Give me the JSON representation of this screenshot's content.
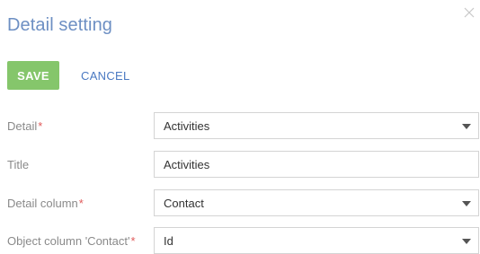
{
  "dialog": {
    "title": "Detail setting"
  },
  "toolbar": {
    "save_label": "SAVE",
    "cancel_label": "CANCEL"
  },
  "icons": {
    "close": "close-icon",
    "dropdown": "chevron-down-icon"
  },
  "colors": {
    "title": "#6d8fc3",
    "save_bg": "#85c66b",
    "cancel": "#4a79c2",
    "required": "#e05a5a"
  },
  "fields": {
    "detail": {
      "label": "Detail",
      "required_mark": "*",
      "value": "Activities"
    },
    "title": {
      "label": "Title",
      "value": "Activities"
    },
    "detail_column": {
      "label": "Detail column",
      "required_mark": "*",
      "value": "Contact"
    },
    "object_column": {
      "label": "Object column 'Contact'",
      "required_mark": "*",
      "value": "Id"
    }
  }
}
